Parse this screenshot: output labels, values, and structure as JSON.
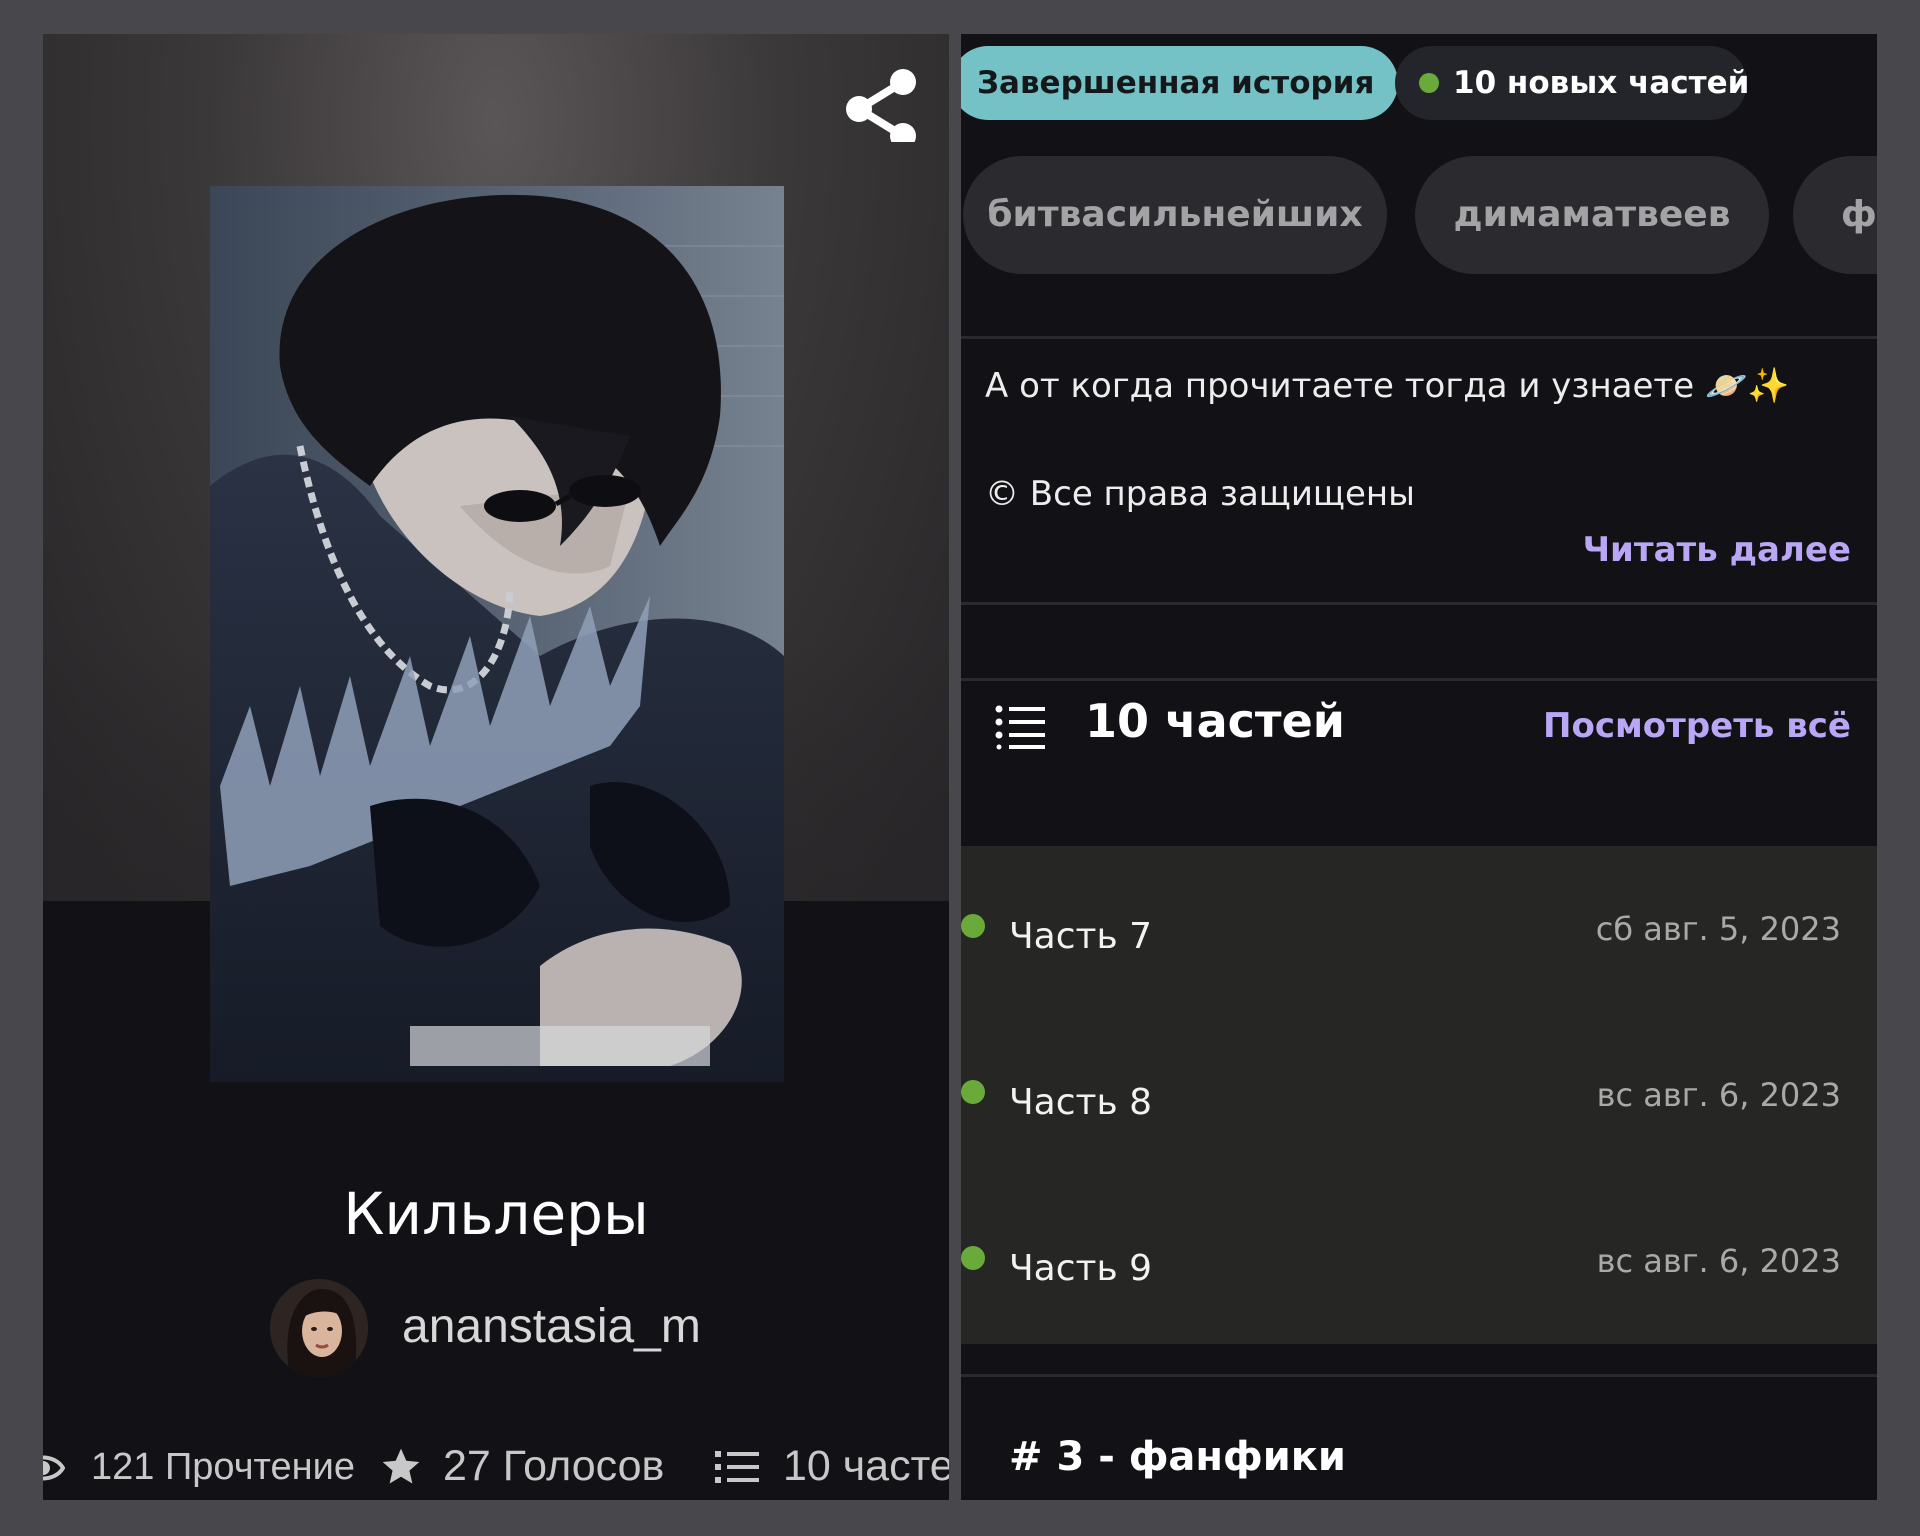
{
  "story": {
    "title": "Кильлеры",
    "author": "ananstasia_m",
    "stats": {
      "reads": "121 Прочтение",
      "votes": "27 Голосов",
      "parts": "10 часте"
    }
  },
  "badges": {
    "complete": "Завершенная история",
    "new_parts": "10 новых частей"
  },
  "tags": [
    "битвасильнейших",
    "димаматвеев",
    "ф"
  ],
  "description": {
    "line1": "А от когда прочитаете тогда и узнаете 🪐✨",
    "line2": "© Все права защищены",
    "read_more": "Читать далее"
  },
  "parts_section": {
    "count_label": "10 частей",
    "see_all": "Посмотреть всё",
    "items": [
      {
        "name": "Часть 7",
        "date": "сб авг. 5, 2023"
      },
      {
        "name": "Часть 8",
        "date": "вс авг. 6, 2023"
      },
      {
        "name": "Часть 9",
        "date": "вс авг. 6, 2023"
      }
    ]
  },
  "ranking": "# 3 - фанфики",
  "icons": [
    "share-icon",
    "eye-icon",
    "star-icon",
    "list-icon",
    "planet-emoji",
    "sparkles-emoji"
  ],
  "colors": {
    "accent": "#b9a6f5",
    "complete_badge": "#74c2c6",
    "new_dot": "#6aaa3a",
    "panel_bg": "#121116"
  }
}
